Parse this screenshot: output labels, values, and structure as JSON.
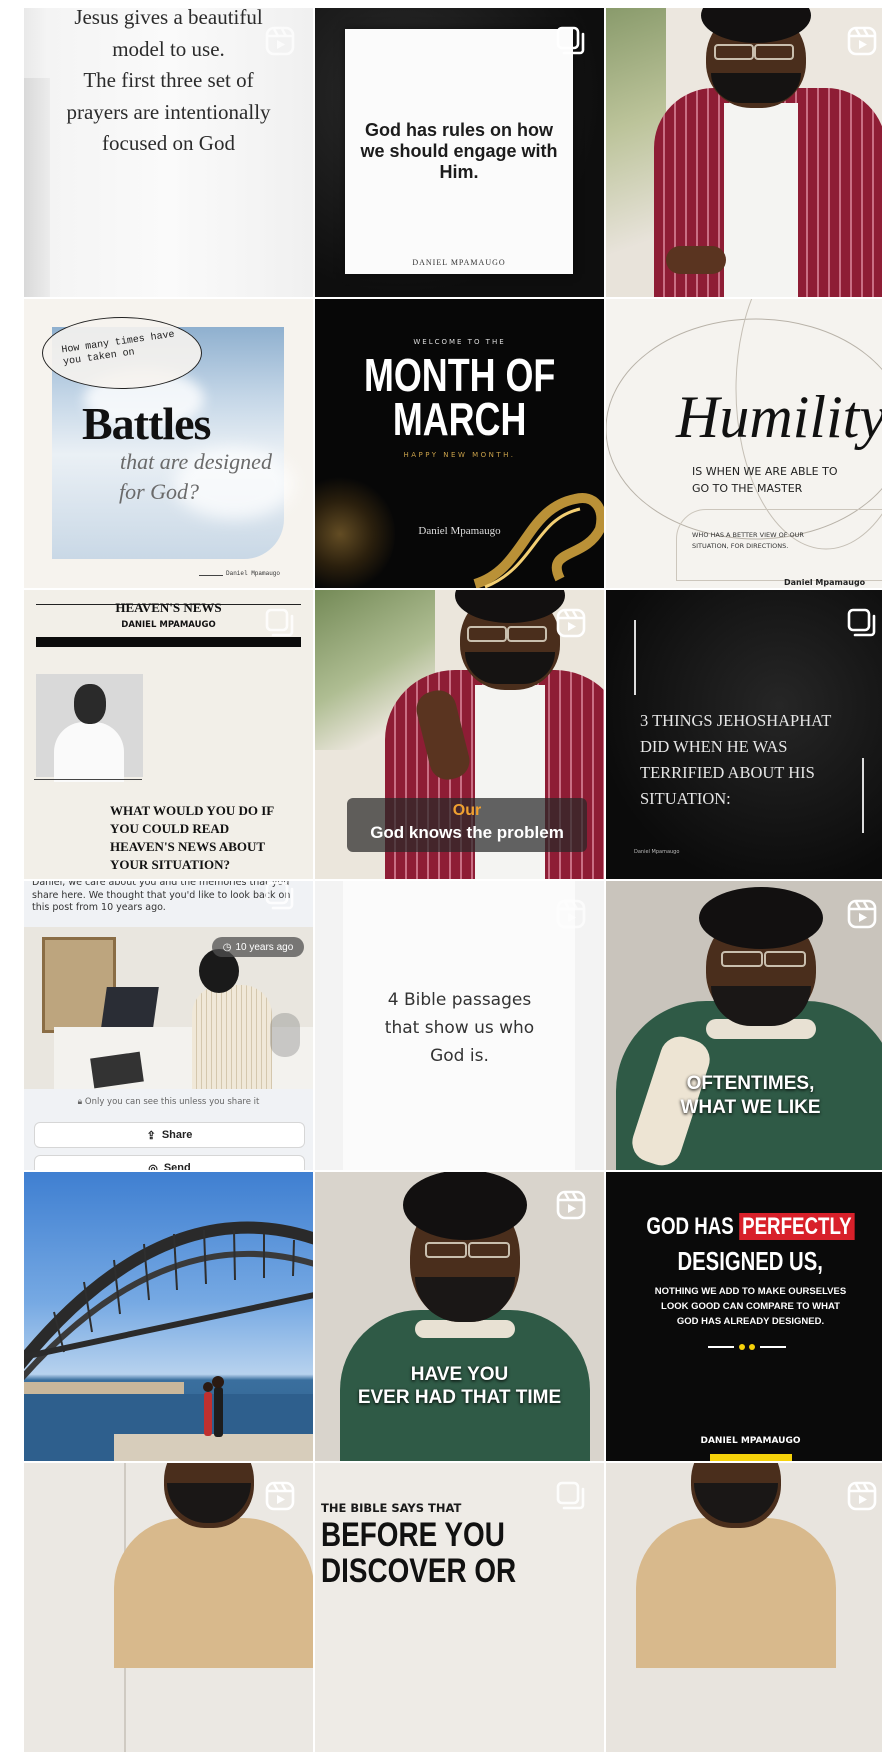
{
  "tiles": {
    "t1": {
      "lines": [
        "Jesus gives a beautiful",
        "model to use.",
        "The first three set of",
        "prayers are intentionally",
        "focused on God"
      ]
    },
    "t2": {
      "quote": "God has rules on how we should engage with Him.",
      "author": "DANIEL MPAMAUGO"
    },
    "t4": {
      "bubble": "How many times have you taken on",
      "big": "Battles",
      "line1": "that are designed",
      "line2": "for God?",
      "sig": "Daniel Mpamaugo"
    },
    "t5": {
      "welcome": "WELCOME TO THE",
      "title1": "MONTH OF",
      "title2": "MARCH",
      "sub": "HAPPY NEW MONTH.",
      "sig": "Daniel Mpamaugo"
    },
    "t6": {
      "big": "Humility",
      "line1": "IS WHEN WE ARE ABLE TO",
      "line2": "GO TO THE MASTER",
      "small1": "WHO HAS A BETTER VIEW OF OUR",
      "small2": "SITUATION, FOR DIRECTIONS.",
      "sig": "Daniel Mpamaugo"
    },
    "t7": {
      "masthead": "HEAVEN'S NEWS",
      "byline": "DANIEL MPAMAUGO",
      "q1": "WHAT WOULD YOU DO IF",
      "q2": "YOU COULD READ",
      "q3": "HEAVEN'S NEWS ABOUT",
      "q4": "YOUR SITUATION?"
    },
    "t8": {
      "cap1": "Our",
      "cap2": "God knows the problem"
    },
    "t9": {
      "l1": "3 THINGS JEHOSHAPHAT",
      "l2": "DID WHEN HE WAS",
      "l3": "TERRIFIED ABOUT HIS",
      "l4": "SITUATION:",
      "sig": "Daniel Mpamaugo"
    },
    "t10": {
      "header1": "Daniel, we care about you and the memories that you",
      "header2": "share here. We thought that you'd like to look back on",
      "header3": "this post from 10 years ago.",
      "ago": "10 years ago",
      "privacy": "Only you can see this unless you share it",
      "share": "Share",
      "send": "Send"
    },
    "t11": {
      "l1": "4 Bible passages",
      "l2": "that show us who",
      "l3": "God is."
    },
    "t12": {
      "cap1": "OFTENTIMES,",
      "cap2": "WHAT WE LIKE"
    },
    "t14": {
      "cap1": "HAVE YOU",
      "cap2": "EVER HAD THAT TIME"
    },
    "t15": {
      "l1a": "GOD HAS",
      "l1b": "PERFECTLY",
      "l2": "DESIGNED US,",
      "s1": "NOTHING WE ADD TO MAKE OURSELVES",
      "s2": "LOOK GOOD CAN COMPARE TO WHAT",
      "s3": "GOD HAS ALREADY DESIGNED.",
      "sig": "DANIEL MPAMAUGO"
    },
    "t17": {
      "l1": "THE BIBLE SAYS THAT",
      "l2": "BEFORE YOU",
      "l3": "DISCOVER OR"
    }
  },
  "colors": {
    "accent_red": "#d8202a",
    "gold": "#c8a04a",
    "caption_orange": "#f0a030",
    "story_yellow": "#f6d20a"
  },
  "icons": {
    "reel": "reel-icon",
    "carousel": "carousel-icon",
    "lock": "lock-icon",
    "share": "share-icon",
    "send": "messenger-icon",
    "clock": "clock-icon"
  }
}
